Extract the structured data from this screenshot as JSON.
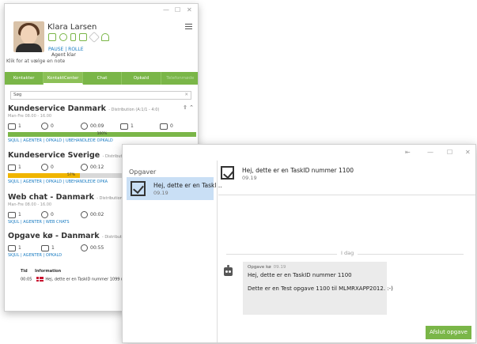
{
  "main_window": {
    "user": {
      "name": "Klara Larsen",
      "pause_role": "PAUSE | ROLLE",
      "status": "Agent klar",
      "note_hint": "Klik for at vælge en note"
    },
    "tabs": [
      {
        "label": "Kontakter"
      },
      {
        "label": "KontaktCenter"
      },
      {
        "label": "Chat"
      },
      {
        "label": "Opkald"
      },
      {
        "label": "Telefonmøde"
      }
    ],
    "search": {
      "value": "Søg"
    },
    "queues": [
      {
        "title": "Kundeservice Danmark",
        "subtitle": "- Distribution (A:1/1 - 4:0)",
        "hours": "Man-Fre 08.00 - 16.00",
        "stats": [
          "1",
          "0",
          "00:09",
          "1",
          "0"
        ],
        "progress_label": "100%",
        "progress_value": 100,
        "progress_color": "#7ab648",
        "links": "SKJUL | AGENTER | OPKALD | UBEHANDLEDE OPKALD"
      },
      {
        "title": "Kundeservice Sverige",
        "subtitle": "- Distribution (A:1/1",
        "stats": [
          "1",
          "0",
          "00:12"
        ],
        "progress_label": "57%",
        "progress_value": 57,
        "progress_color": "#f0b500",
        "links": "SKJUL | AGENTER | OPKALD | UBEHANDLEDE OPKA"
      },
      {
        "title": "Web chat - Danmark",
        "subtitle": "- Distribution",
        "hours": "Man-Fre 08.00 - 16.00",
        "stats": [
          "1",
          "0",
          "00:02"
        ],
        "links": "SKJUL | AGENTER | WEB CHATS"
      },
      {
        "title": "Opgave kø - Danmark",
        "subtitle": "- Distribution",
        "stats": [
          "1",
          "1",
          "00:55"
        ],
        "links": "SKJUL | AGENTER | OPKALD"
      }
    ],
    "table": {
      "headers": [
        "Tid",
        "Information"
      ],
      "row": {
        "time": "00:05",
        "info": "Hej, dette er en TaskID nummer 1099 (1"
      }
    }
  },
  "task_window": {
    "list_title": "Opgaver",
    "list_item": {
      "title": "Hej, dette er en Taskl...",
      "time": "09.19"
    },
    "header": {
      "title": "Hej, dette er en TaskID nummer 1100",
      "time": "09.19"
    },
    "divider_label": "I dag",
    "message": {
      "sender": "Opgave kø",
      "time": "09.19",
      "line1": "Hej, dette er en TaskID nummer 1100",
      "line2": "Dette er en Test opgave 1100 til MLMRXAPP2012. :-)"
    },
    "finish_button": "Afslut opgave"
  },
  "colors": {
    "accent_green": "#7ab648",
    "link_blue": "#1a7cc2",
    "warning": "#f0b500",
    "selection": "#c9dff5"
  }
}
